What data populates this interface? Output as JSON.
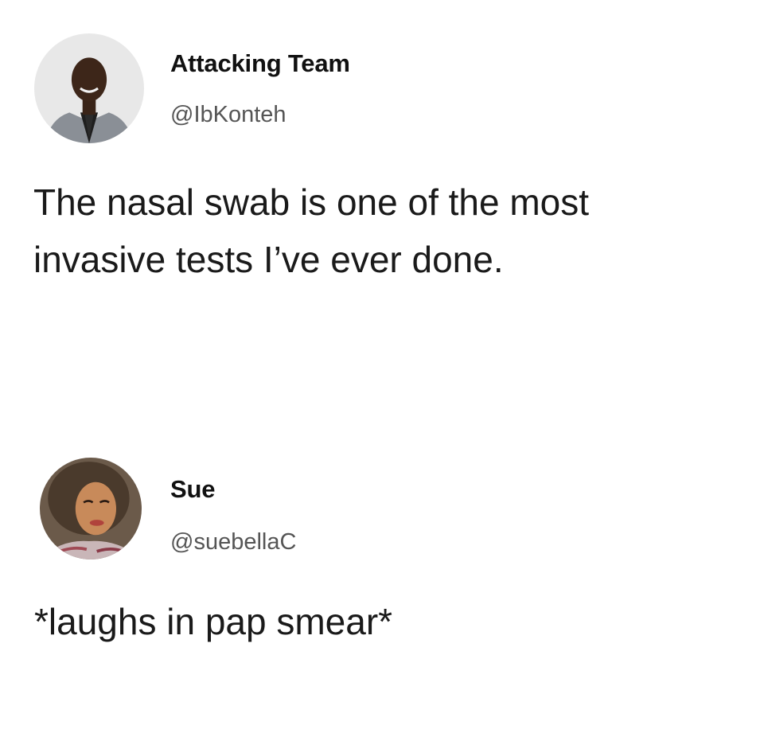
{
  "tweets": [
    {
      "display_name": "Attacking Team",
      "handle": "@IbKonteh",
      "text_lines": [
        "The nasal swab is one of the most",
        "invasive tests I’ve ever done."
      ]
    },
    {
      "display_name": "Sue",
      "handle": "@suebellaC",
      "text_lines": [
        "*laughs in pap smear*"
      ]
    }
  ]
}
